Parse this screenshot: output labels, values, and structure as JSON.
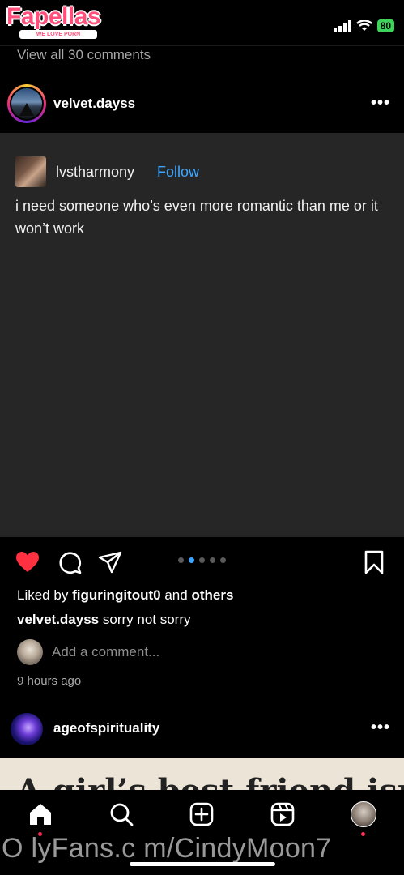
{
  "watermark": {
    "brand": "Fapellas",
    "tagline": "WE LOVE PORN",
    "footer": "O lyFans.c m/CindyMoon7"
  },
  "status_bar": {
    "battery": "80"
  },
  "feed": {
    "view_comments": "View all 30 comments",
    "post": {
      "username": "velvet.dayss",
      "quoted": {
        "username": "lvstharmony",
        "follow_label": "Follow",
        "text": "i need someone who’s even more romantic than me or it won’t work"
      },
      "carousel": {
        "count": 5,
        "active_index": 1
      },
      "liked_by_prefix": "Liked by",
      "liked_by_user": "figuringitout0",
      "liked_by_and": "and",
      "liked_by_others": "others",
      "caption_user": "velvet.dayss",
      "caption_text": "sorry not sorry",
      "add_comment_placeholder": "Add a comment...",
      "time_ago": "9 hours ago",
      "liked": true
    },
    "next_post": {
      "username": "ageofspirituality",
      "media_text": "A girl’s best friend isn’t"
    }
  },
  "colors": {
    "like_red": "#ff3040",
    "link_blue": "#3ea6ff",
    "notification_dot": "#ff2d55"
  },
  "bottom_nav": [
    "home-icon",
    "search-icon",
    "create-icon",
    "reels-icon",
    "profile-avatar"
  ]
}
